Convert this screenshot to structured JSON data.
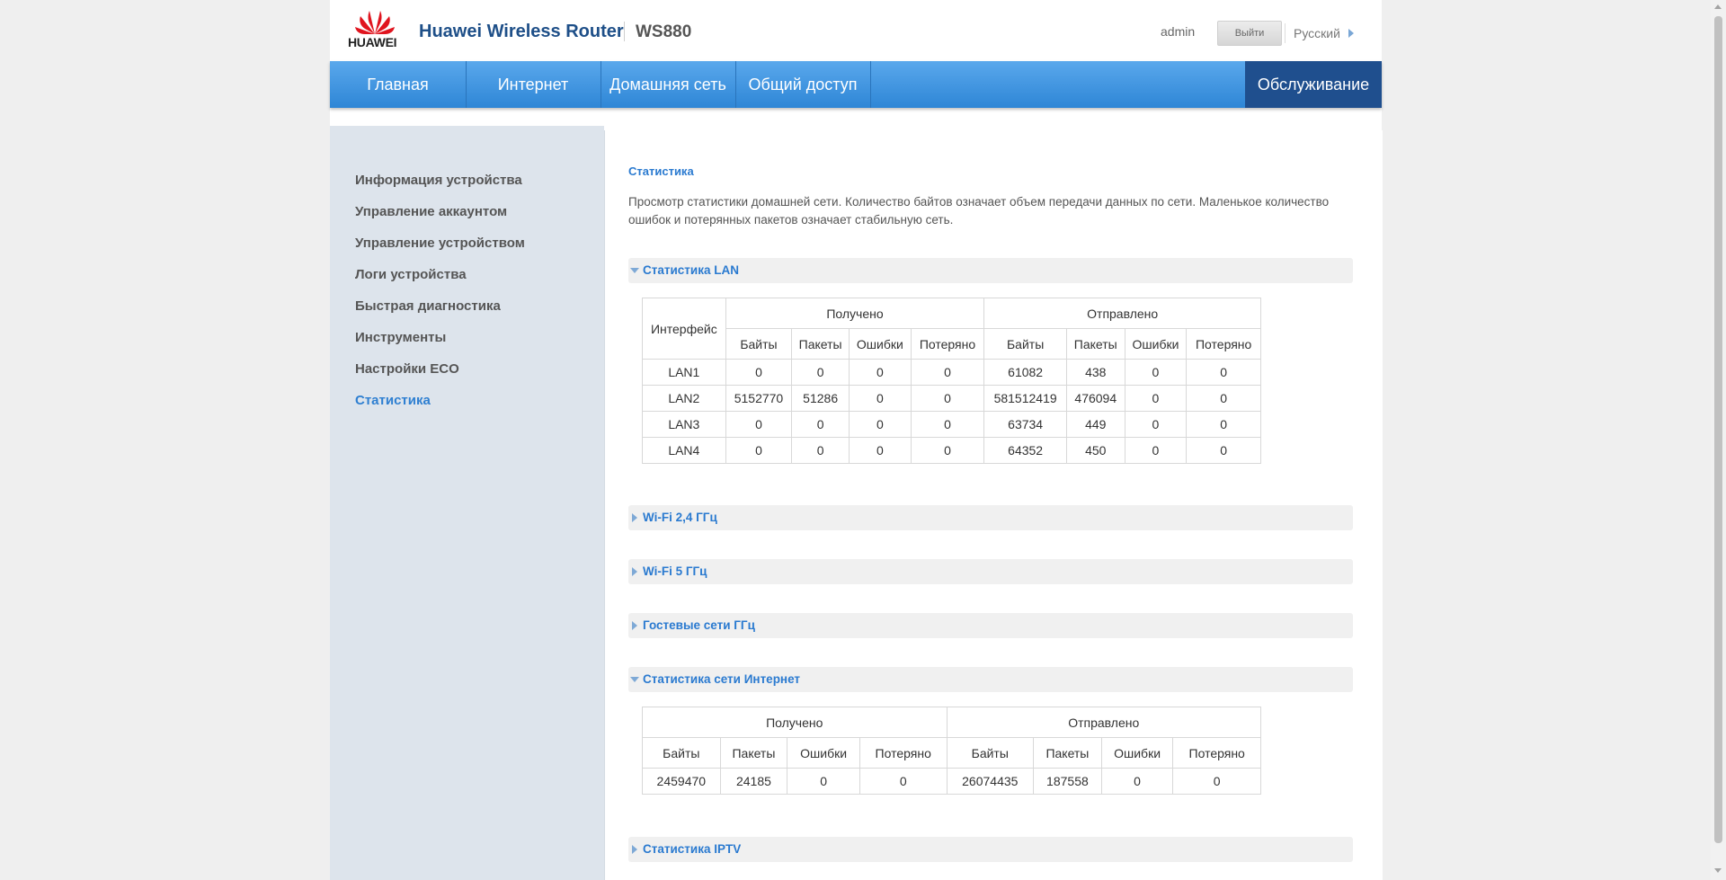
{
  "header": {
    "brand": "HUAWEI",
    "title": "Huawei Wireless Router",
    "model": "WS880",
    "user": "admin",
    "logout_label": "Выйти",
    "language": "Русский"
  },
  "nav": {
    "items": [
      "Главная",
      "Интернет",
      "Домашняя сеть",
      "Общий доступ",
      "Обслуживание"
    ],
    "active": "Обслуживание"
  },
  "sidebar": {
    "items": [
      "Информация устройства",
      "Управление аккаунтом",
      "Управление устройством",
      "Логи устройства",
      "Быстрая диагностика",
      "Инструменты",
      "Настройки ECO",
      "Статистика"
    ],
    "active": "Статистика"
  },
  "content": {
    "title": "Статистика",
    "description": "Просмотр статистики домашней сети. Количество байтов означает объем передачи данных по сети. Маленькое количество ошибок и потерянных пакетов означает стабильную сеть.",
    "sections": {
      "lan": "Статистика LAN",
      "wifi24": "Wi-Fi 2,4 ГГц",
      "wifi5": "Wi-Fi 5 ГГц",
      "guest": "Гостевые сети ГГц",
      "internet": "Статистика сети Интернет",
      "iptv": "Статистика IPTV"
    },
    "lan_table": {
      "col_interface": "Интерфейс",
      "group_received": "Получено",
      "group_sent": "Отправлено",
      "subcols": [
        "Байты",
        "Пакеты",
        "Ошибки",
        "Потеряно"
      ],
      "rows": [
        [
          "LAN1",
          "0",
          "0",
          "0",
          "0",
          "61082",
          "438",
          "0",
          "0"
        ],
        [
          "LAN2",
          "5152770",
          "51286",
          "0",
          "0",
          "581512419",
          "476094",
          "0",
          "0"
        ],
        [
          "LAN3",
          "0",
          "0",
          "0",
          "0",
          "63734",
          "449",
          "0",
          "0"
        ],
        [
          "LAN4",
          "0",
          "0",
          "0",
          "0",
          "64352",
          "450",
          "0",
          "0"
        ]
      ]
    },
    "internet_table": {
      "group_received": "Получено",
      "group_sent": "Отправлено",
      "subcols": [
        "Байты",
        "Пакеты",
        "Ошибки",
        "Потеряно"
      ],
      "row": [
        "2459470",
        "24185",
        "0",
        "0",
        "26074435",
        "187558",
        "0",
        "0"
      ]
    }
  },
  "colors": {
    "nav_bg": "#3b93e0",
    "nav_active": "#1f4f8e",
    "accent": "#2a7ad0",
    "sidebar_bg": "#dde4ec"
  }
}
